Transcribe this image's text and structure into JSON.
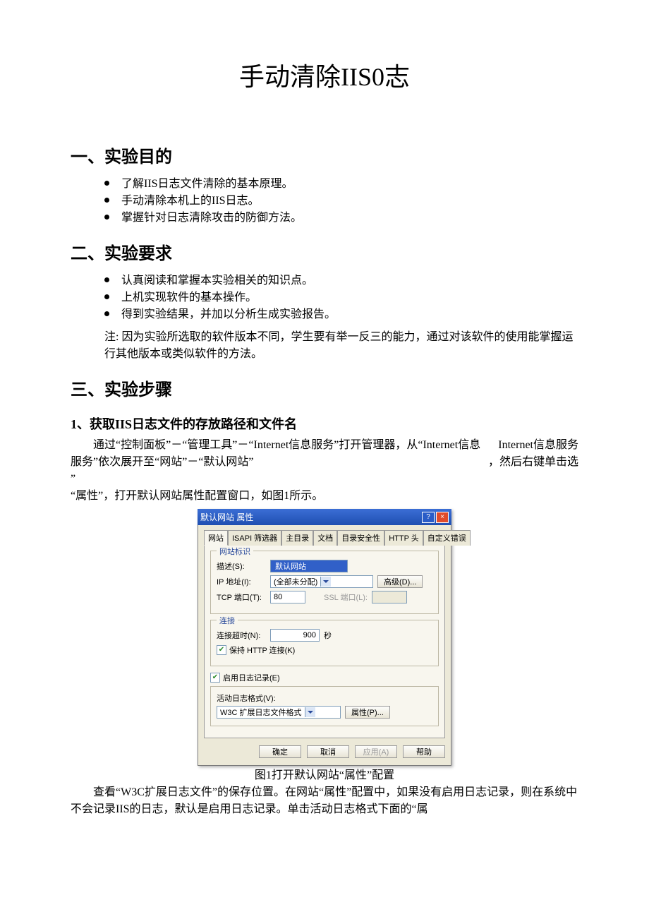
{
  "title": "手动清除IIS0志",
  "sections": {
    "s1": {
      "heading": "一、实验目的",
      "items": [
        "了解IIS日志文件清除的基本原理。",
        "手动清除本机上的IIS日志。",
        "掌握针对日志清除攻击的防御方法。"
      ]
    },
    "s2": {
      "heading": "二、实验要求",
      "items": [
        "认真阅读和掌握本实验相关的知识点。",
        "上机实现软件的基本操作。",
        "得到实验结果，并加以分析生成实验报告。"
      ],
      "note": "注: 因为实验所选取的软件版本不同，学生要有举一反三的能力，通过对该软件的使用能掌握运行其他版本或类似软件的方法。"
    },
    "s3": {
      "heading": "三、实验步骤",
      "sub1": {
        "heading": "1、获取IIS日志文件的存放路径和文件名",
        "right1": "Internet信息服务",
        "right2": "，然后右键单击选",
        "para1": "通过“控制面板”－“管理工具”－“Internet信息服务”打开管理器，从“Internet信息服务”依次展开至“网站”－“默认网站”",
        "para2": "“属性”，打开默认网站属性配置窗口，如图1所示。",
        "caption": "图1打开默认网站“属性”配置",
        "para3": "查看“W3C扩展日志文件”的保存位置。在网站“属性”配置中，如果没有启用日志记录，则在系统中不会记录IIS的日志，默认是启用日志记录。单击活动日志格式下面的“属"
      }
    }
  },
  "dialog": {
    "titlebar": "默认网站 属性",
    "help": "?",
    "close": "×",
    "tabs": [
      "网站",
      "ISAPI 筛选器",
      "主目录",
      "文档",
      "目录安全性",
      "HTTP 头",
      "自定义错误"
    ],
    "group_ident": {
      "title": "网站标识",
      "desc_label": "描述(S):",
      "desc_value": "默认网站",
      "ip_label": "IP 地址(I):",
      "ip_value": "(全部未分配)",
      "adv": "高级(D)...",
      "tcp_label": "TCP 端口(T):",
      "tcp_value": "80",
      "ssl_label": "SSL 端口(L):"
    },
    "group_conn": {
      "title": "连接",
      "timeout_label": "连接超时(N):",
      "timeout_value": "900",
      "sec": "秒",
      "keep_http": "保持 HTTP 连接(K)"
    },
    "logging": {
      "enable": "启用日志记录(E)",
      "fmt_label": "活动日志格式(V):",
      "fmt_value": "W3C 扩展日志文件格式",
      "prop_btn": "属性(P)..."
    },
    "buttons": {
      "ok": "确定",
      "cancel": "取消",
      "apply": "应用(A)",
      "help": "帮助"
    }
  }
}
